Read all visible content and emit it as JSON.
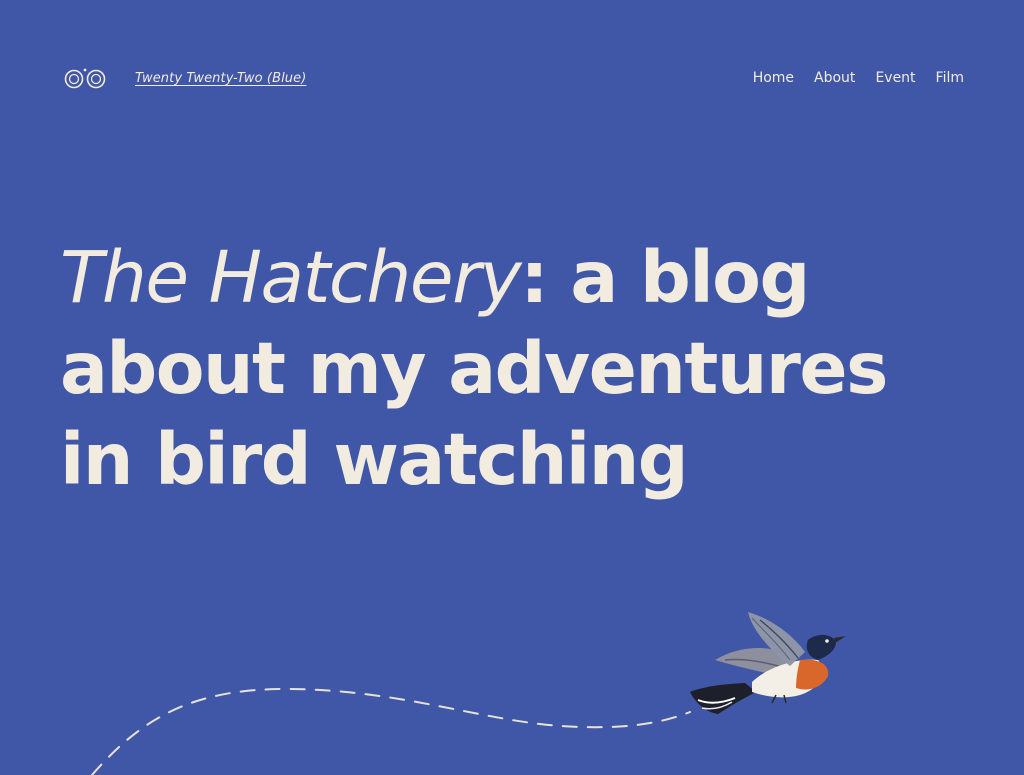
{
  "header": {
    "logo_icon": "binoculars-icon",
    "site_title": "Twenty Twenty-Two (Blue)"
  },
  "nav": {
    "items": [
      {
        "label": "Home"
      },
      {
        "label": "About"
      },
      {
        "label": "Event"
      },
      {
        "label": "Film"
      }
    ]
  },
  "hero": {
    "title_emphasis": "The Hatchery",
    "title_rest": ": a blog about my adventures in bird watching"
  },
  "illustration": {
    "icon": "flying-bird-illustration",
    "path_icon": "dashed-flight-path"
  },
  "colors": {
    "background": "#3f57a6",
    "foreground": "#f2ebe0"
  }
}
